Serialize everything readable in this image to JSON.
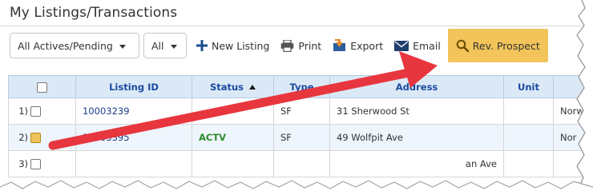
{
  "page_title": "My Listings/Transactions",
  "toolbar": {
    "filter_select": "All Actives/Pending",
    "type_select": "All",
    "new_listing": "New Listing",
    "print": "Print",
    "export": "Export",
    "email": "Email",
    "rev_prospect": "Rev. Prospect"
  },
  "colors": {
    "accent": "#f2c45a",
    "header_bg": "#dbe9f7",
    "header_text": "#1b4a9e",
    "arrow": "#e8363f",
    "status_active": "#2e8b2e"
  },
  "icons": [
    "plus-icon",
    "printer-icon",
    "export-icon",
    "envelope-icon",
    "search-icon",
    "sort-up-icon"
  ],
  "table": {
    "columns": [
      "",
      "Listing ID",
      "Status",
      "Type",
      "Address",
      "Unit",
      ""
    ],
    "rows": [
      {
        "num": "1)",
        "listing_id": "10003239",
        "status": "",
        "type": "SF",
        "address": "31 Sherwood St",
        "unit": "",
        "city": "Norw"
      },
      {
        "num": "2)",
        "listing_id": "10003395",
        "status": "ACTV",
        "type": "SF",
        "address": "49 Wolfpit Ave",
        "unit": "",
        "city": "Nor"
      },
      {
        "num": "3)",
        "listing_id": "",
        "status": "",
        "type": "",
        "address": "an Ave",
        "unit": "",
        "city": ""
      }
    ]
  }
}
